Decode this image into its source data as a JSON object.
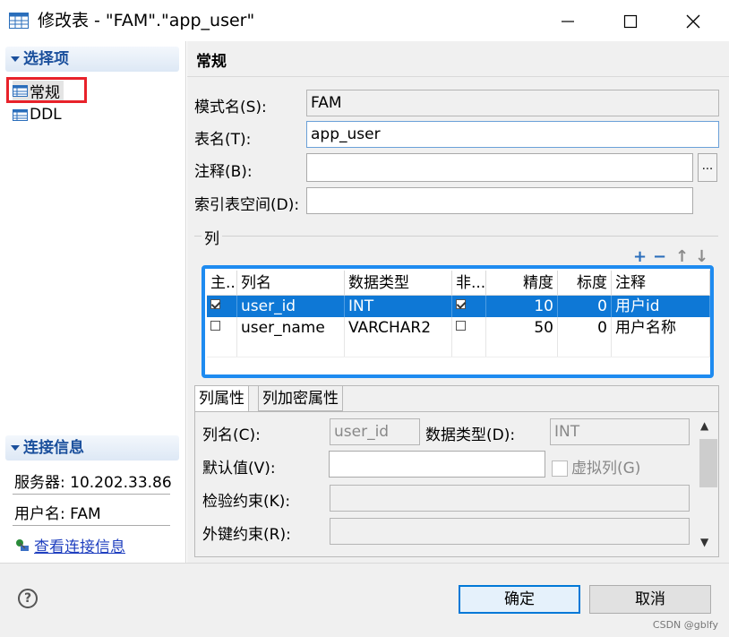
{
  "window": {
    "title": "修改表 - \"FAM\".\"app_user\""
  },
  "left": {
    "sections": {
      "options": "选择项",
      "connection": "连接信息"
    },
    "nav": [
      {
        "label": "常规"
      },
      {
        "label": "DDL"
      }
    ],
    "info": {
      "server": "服务器: 10.202.33.86",
      "user": "用户名: FAM",
      "link": "查看连接信息"
    }
  },
  "right": {
    "title": "常规",
    "fields": {
      "schema_label": "模式名(S):",
      "schema_value": "FAM",
      "table_label": "表名(T):",
      "table_value": "app_user",
      "comment_label": "注释(B):",
      "comment_value": "",
      "comment_more": "...",
      "tablespace_label": "索引表空间(D):",
      "tablespace_value": ""
    },
    "columns_group": "列",
    "toolbar": {
      "add": "+",
      "remove": "−",
      "up": "↑",
      "down": "↓"
    },
    "table": {
      "headers": [
        "主...",
        "列名",
        "数据类型",
        "非...",
        "精度",
        "标度",
        "注释"
      ],
      "rows": [
        {
          "pk": true,
          "name": "user_id",
          "type": "INT",
          "notnull": true,
          "precision": "10",
          "scale": "0",
          "comment": "用户id"
        },
        {
          "pk": false,
          "name": "user_name",
          "type": "VARCHAR2",
          "notnull": false,
          "precision": "50",
          "scale": "0",
          "comment": "用户名称"
        }
      ]
    },
    "tabs": [
      "列属性",
      "列加密属性"
    ],
    "props": {
      "colname_label": "列名(C):",
      "colname_value": "user_id",
      "datatype_label": "数据类型(D):",
      "datatype_value": "INT",
      "default_label": "默认值(V):",
      "default_value": "",
      "virtual_label": "虚拟列(G)",
      "check_label": "检验约束(K):",
      "check_value": "",
      "fk_label": "外键约束(R):",
      "fk_value": ""
    }
  },
  "buttons": {
    "help": "?",
    "ok": "确定",
    "cancel": "取消"
  },
  "watermark": "CSDN @gblfy",
  "colors": {
    "accent": "#0e78d6",
    "highlight_box": "#e8222a",
    "table_frame": "#1e8bf0",
    "section_text": "#1a4f9c"
  }
}
